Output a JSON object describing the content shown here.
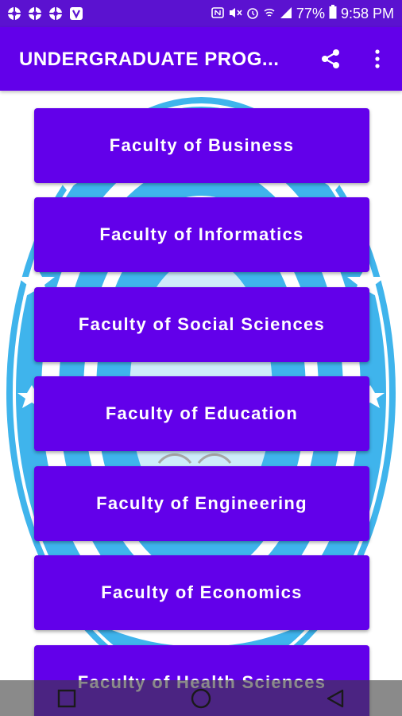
{
  "status_bar": {
    "battery": "77%",
    "time": "9:58 PM",
    "left_icons": [
      "app-notification-icon",
      "app-notification-icon",
      "app-notification-icon",
      "v-app-icon"
    ],
    "right_icons": [
      "nfc-icon",
      "mute-icon",
      "alarm-icon",
      "wifi-icon",
      "signal-icon",
      "battery-icon"
    ]
  },
  "app_bar": {
    "title": "UNDERGRADUATE PROG...",
    "actions": [
      "share-icon",
      "more-vert-icon"
    ]
  },
  "faculties": [
    {
      "label": "Faculty of Business"
    },
    {
      "label": "Faculty of Informatics"
    },
    {
      "label": "Faculty of Social Sciences"
    },
    {
      "label": "Faculty of Education"
    },
    {
      "label": "Faculty of Engineering"
    },
    {
      "label": "Faculty of Economics"
    },
    {
      "label": "Faculty of Health Sciences"
    }
  ],
  "nav_bar": {
    "buttons": [
      "recents-icon",
      "home-icon",
      "back-icon"
    ]
  },
  "colors": {
    "primary": "#6200ea",
    "status_bar": "#5b12d0",
    "logo_blue": "#3fb4ec"
  }
}
